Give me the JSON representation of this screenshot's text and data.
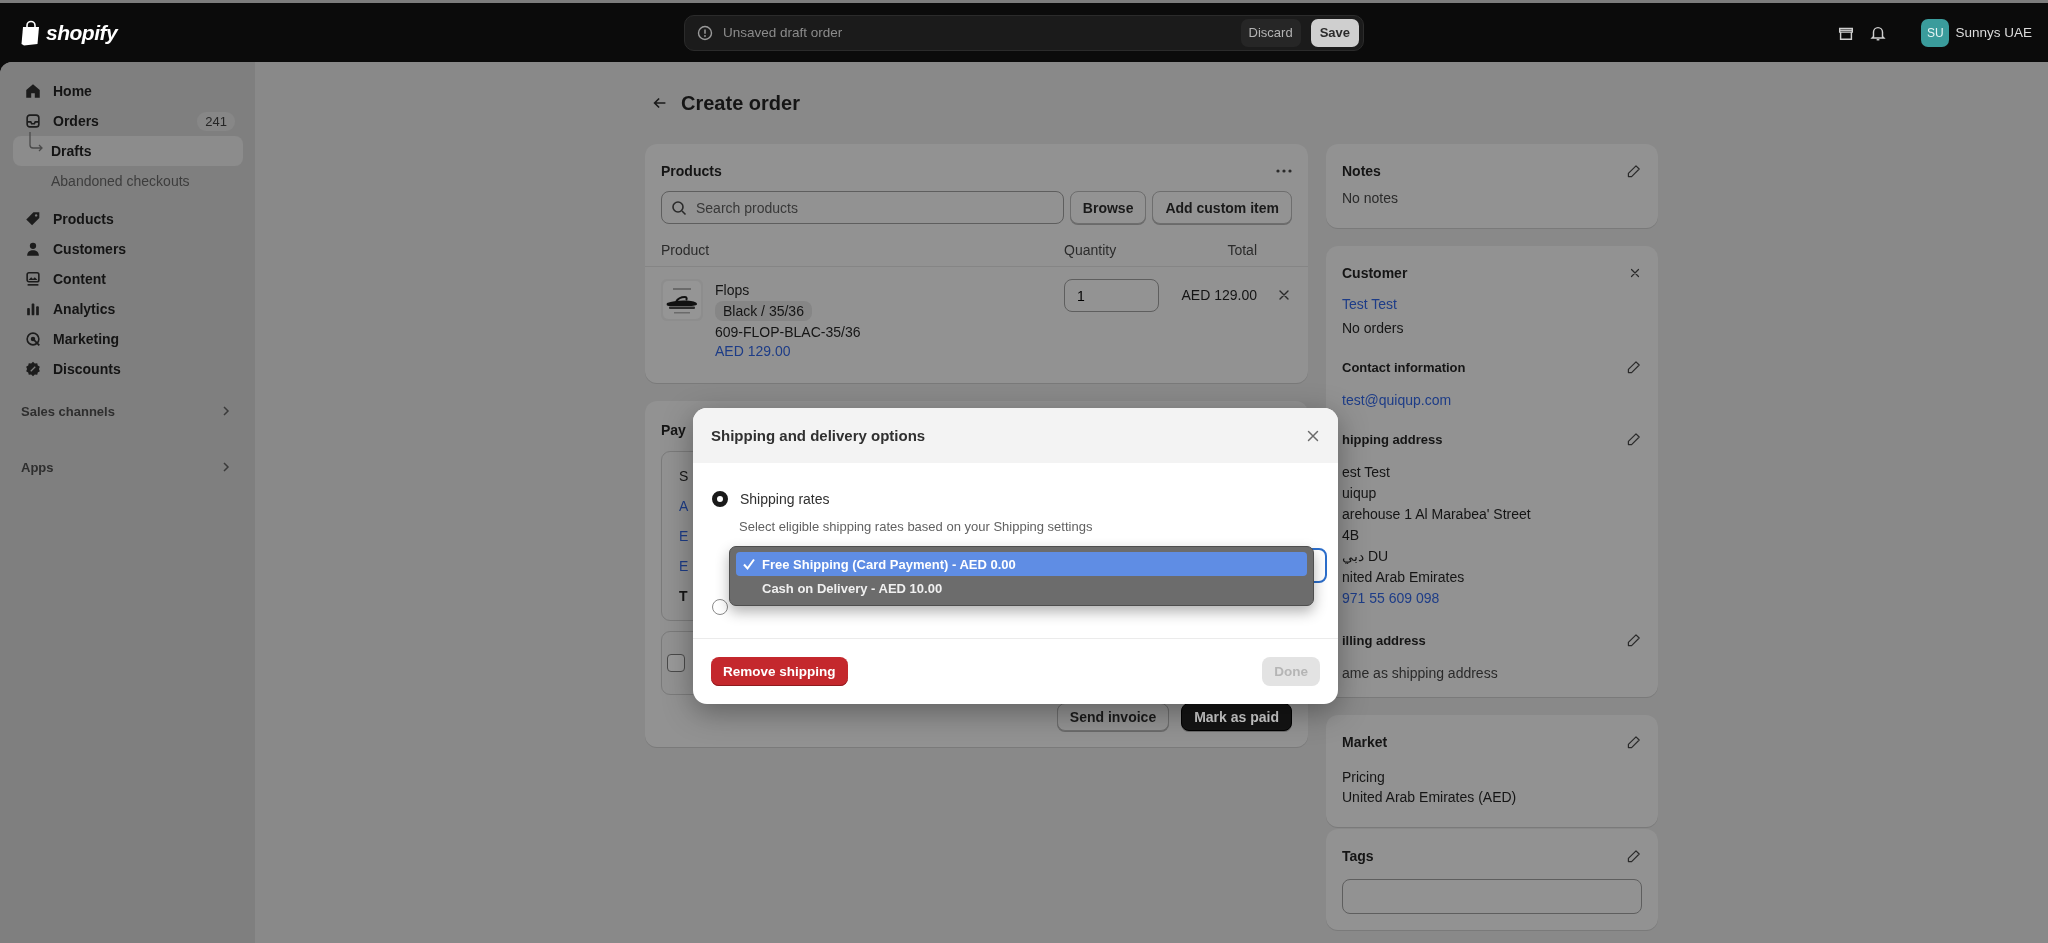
{
  "topbar": {
    "logo": "shopify",
    "status": "Unsaved draft order",
    "discard": "Discard",
    "save": "Save",
    "avatar": "SU",
    "store": "Sunnys UAE"
  },
  "sidebar": {
    "items": [
      {
        "label": "Home",
        "selected": false
      },
      {
        "label": "Orders",
        "badge": "241",
        "selected": false,
        "children": [
          {
            "label": "Drafts",
            "selected": true
          },
          {
            "label": "Abandoned checkouts",
            "selected": false
          }
        ]
      },
      {
        "label": "Products",
        "selected": false
      },
      {
        "label": "Customers",
        "selected": false
      },
      {
        "label": "Content",
        "selected": false
      },
      {
        "label": "Analytics",
        "selected": false
      },
      {
        "label": "Marketing",
        "selected": false
      },
      {
        "label": "Discounts",
        "selected": false
      }
    ],
    "sections": [
      "Sales channels",
      "Apps"
    ]
  },
  "page_title": "Create order",
  "products": {
    "title": "Products",
    "search_placeholder": "Search products",
    "browse": "Browse",
    "add_custom": "Add custom item",
    "columns": [
      "Product",
      "Quantity",
      "Total"
    ],
    "rows": [
      {
        "name": "Flops",
        "variant": "Black / 35/36",
        "sku": "609-FLOP-BLAC-35/36",
        "price": "AED 129.00",
        "quantity": "1",
        "total": "AED 129.00"
      }
    ]
  },
  "payment": {
    "title": "Pay",
    "lines": [
      {
        "text": "S",
        "kind": "label"
      },
      {
        "text": "A",
        "kind": "link"
      },
      {
        "text": "E",
        "kind": "link"
      },
      {
        "text": "E",
        "kind": "link"
      },
      {
        "text": "T",
        "kind": "total"
      }
    ],
    "checkbox": {
      "checked": false
    },
    "send_invoice": "Send invoice",
    "mark_paid": "Mark as paid"
  },
  "notes": {
    "title": "Notes",
    "text": "No notes"
  },
  "customer": {
    "title": "Customer",
    "name": "Test Test",
    "orders": "No orders",
    "contact_title": "Contact information",
    "email": "test@quiqup.com",
    "shipping_title": "hipping address",
    "shipping_lines": [
      "est Test",
      "uiqup",
      "arehouse 1 Al Marabea' Street",
      "4B",
      "دبي DU",
      "nited Arab Emirates"
    ],
    "phone": "971 55 609 098",
    "billing_title": "illing address",
    "billing_text": "ame as shipping address"
  },
  "market": {
    "title": "Market",
    "label": "Pricing",
    "value": "United Arab Emirates (AED)"
  },
  "tags": {
    "title": "Tags"
  },
  "modal": {
    "title": "Shipping and delivery options",
    "options": [
      {
        "label": "Shipping rates",
        "hint": "Select eligible shipping rates based on your Shipping settings",
        "selected": true
      },
      {
        "selected": false
      }
    ],
    "dropdown": [
      {
        "label": "Free Shipping (Card Payment) - AED 0.00",
        "selected": true
      },
      {
        "label": "Cash on Delivery - AED 10.00",
        "selected": false
      }
    ],
    "remove": "Remove shipping",
    "done": {
      "label": "Done",
      "disabled": true
    }
  }
}
